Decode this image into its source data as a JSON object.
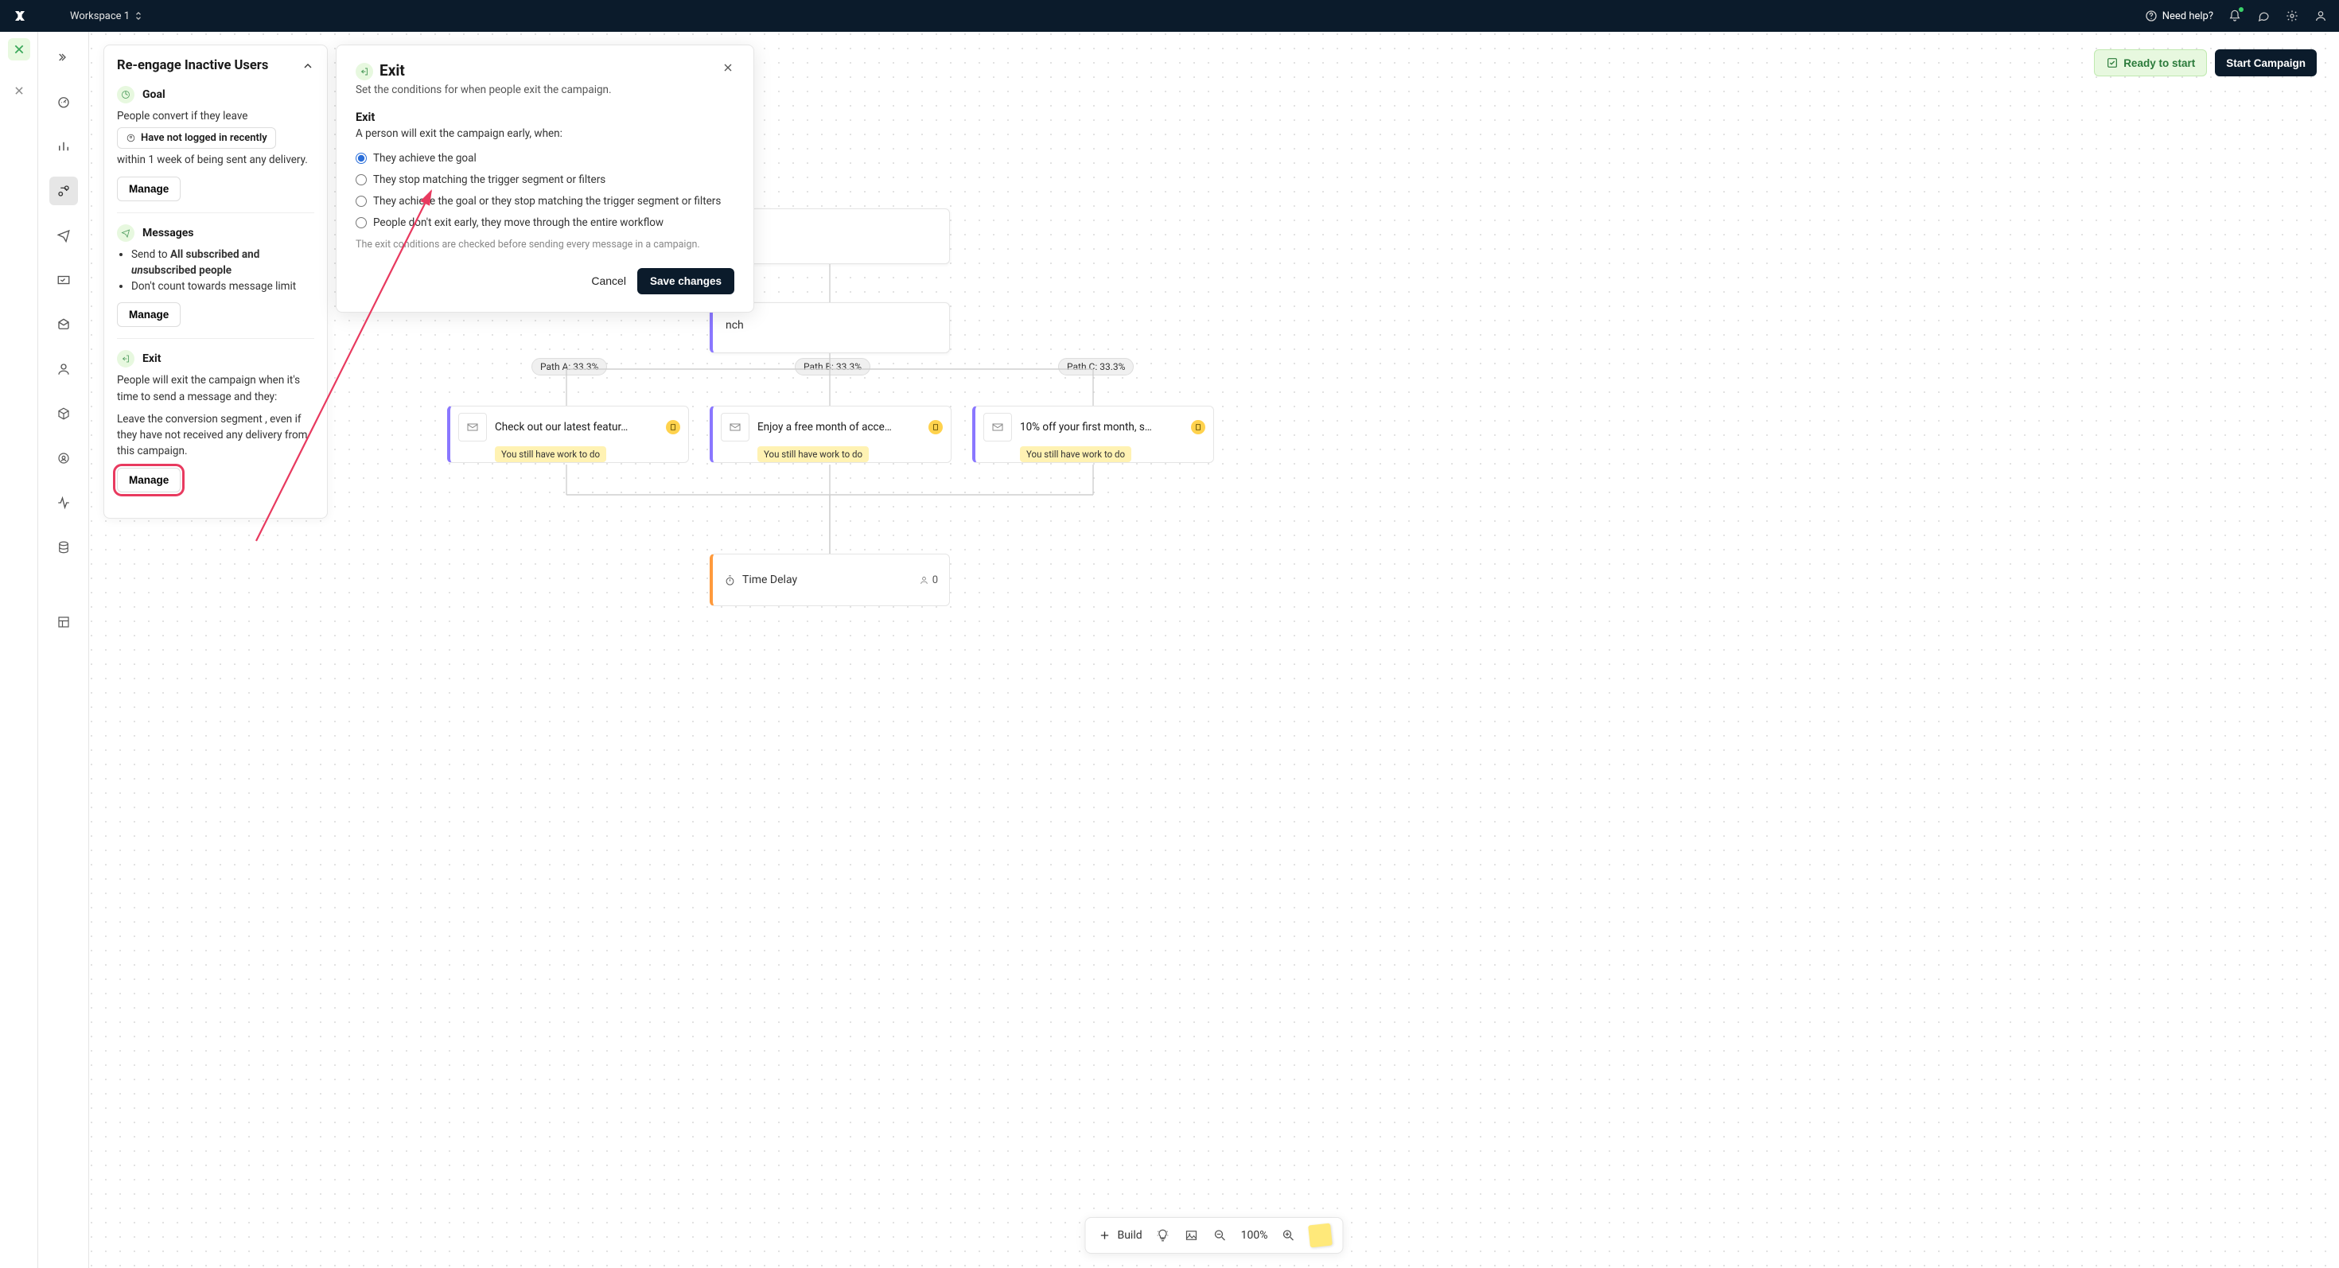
{
  "topbar": {
    "workspace": "Workspace 1",
    "need_help": "Need help?"
  },
  "canvas_header": {
    "ready": "Ready to start",
    "start": "Start Campaign"
  },
  "side_panel": {
    "title": "Re-engage Inactive Users",
    "goal": {
      "label": "Goal",
      "convert_text": "People convert if they leave",
      "segment_chip": "Have not logged in recently",
      "within_text": "within 1 week of being sent any delivery.",
      "manage": "Manage"
    },
    "messages": {
      "label": "Messages",
      "bullet1_pre": "Send to ",
      "bullet1_strong": "All subscribed and ",
      "bullet1_em": "un",
      "bullet1_rest": "subscribed people",
      "bullet2": "Don't count towards message limit",
      "manage": "Manage"
    },
    "exit": {
      "label": "Exit",
      "p1": "People will exit the campaign when it's time to send a message and they:",
      "p2": "Leave the conversion segment , even if they have not received any delivery from this campaign.",
      "manage": "Manage"
    }
  },
  "modal": {
    "title": "Exit",
    "subtitle": "Set the conditions for when people exit the campaign.",
    "heading": "Exit",
    "lead": "A person will exit the campaign early, when:",
    "options": [
      "They achieve the goal",
      "They stop matching the trigger segment or filters",
      "They achieve the goal or they stop matching the trigger segment or filters",
      "People don't exit early, they move through the entire workflow"
    ],
    "note": "The exit conditions are checked before sending every message in a campaign.",
    "cancel": "Cancel",
    "save": "Save changes"
  },
  "flow": {
    "branch_partial": "nch",
    "paths": [
      {
        "label": "Path A: 33.3%"
      },
      {
        "label": "Path B: 33.3%"
      },
      {
        "label": "Path C: 33.3%"
      }
    ],
    "messages": [
      {
        "title": "Check out our latest featur…",
        "work": "You still have work to do"
      },
      {
        "title": "Enjoy a free month of acce…",
        "work": "You still have work to do"
      },
      {
        "title": "10% off your first month, s…",
        "work": "You still have work to do"
      }
    ],
    "delay": {
      "title": "Time Delay",
      "count": "0"
    }
  },
  "bottom_bar": {
    "build": "Build",
    "zoom": "100%"
  }
}
